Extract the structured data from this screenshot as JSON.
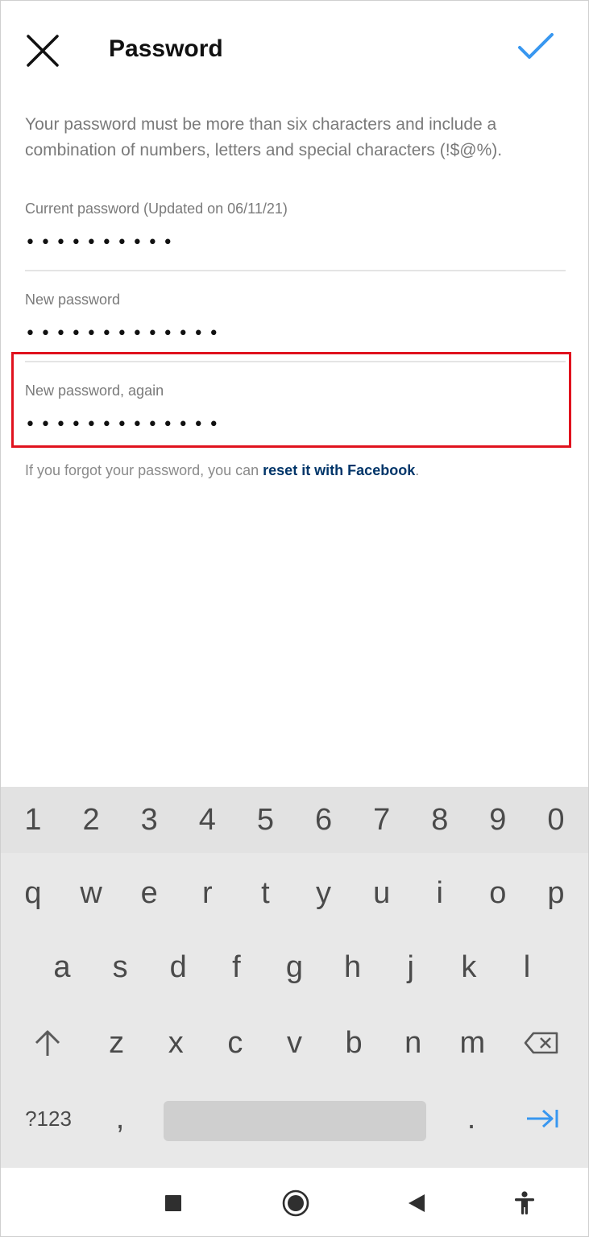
{
  "header": {
    "title": "Password",
    "close_icon": "close-icon",
    "confirm_icon": "checkmark-icon",
    "accent_color": "#3897f0"
  },
  "description": "Your password must be more than six characters and include a combination of numbers, letters and special characters (!$@%).",
  "fields": {
    "current": {
      "label": "Current password (Updated on 06/11/21)",
      "value": "••••••••••"
    },
    "new": {
      "label": "New password",
      "value": "•••••••••••••"
    },
    "again": {
      "label": "New password, again",
      "value": "•••••••••••••"
    }
  },
  "highlight_color": "#e0121e",
  "forgot": {
    "prefix": "If you forgot your password, you can ",
    "link": "reset it with Facebook",
    "suffix": "."
  },
  "keyboard": {
    "numbers": [
      "1",
      "2",
      "3",
      "4",
      "5",
      "6",
      "7",
      "8",
      "9",
      "0"
    ],
    "row1": [
      "q",
      "w",
      "e",
      "r",
      "t",
      "y",
      "u",
      "i",
      "o",
      "p"
    ],
    "row2": [
      "a",
      "s",
      "d",
      "f",
      "g",
      "h",
      "j",
      "k",
      "l"
    ],
    "row3": [
      "z",
      "x",
      "c",
      "v",
      "b",
      "n",
      "m"
    ],
    "symbols_label": "?123",
    "comma": ",",
    "period": ".",
    "shift_icon": "shift-arrow-icon",
    "backspace_icon": "backspace-icon",
    "next_icon": "tab-next-icon"
  },
  "navbar": {
    "recents_icon": "square-icon",
    "home_icon": "circle-icon",
    "back_icon": "triangle-back-icon",
    "accessibility_icon": "accessibility-icon"
  }
}
